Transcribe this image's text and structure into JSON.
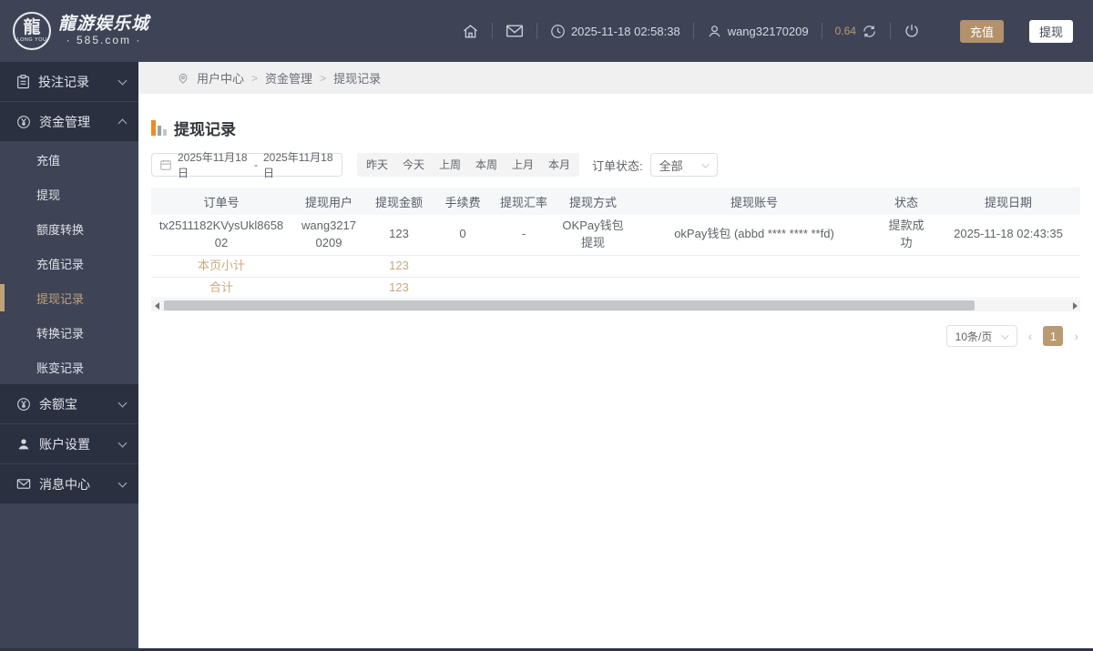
{
  "topbar": {
    "brand_cn": "龍游娱乐城",
    "brand_sub": "· 585.com ·",
    "brand_badge": "LONG YOU",
    "brand_glyph": "龍",
    "datetime": "2025-11-18 02:58:38",
    "username": "wang32170209",
    "balance": "0.64",
    "deposit_label": "充值",
    "withdraw_label": "提现"
  },
  "sidebar": {
    "groups": [
      "投注记录",
      "资金管理",
      "余额宝",
      "账户设置",
      "消息中心"
    ],
    "funds_children": [
      "充值",
      "提现",
      "额度转换",
      "充值记录",
      "提现记录",
      "转换记录",
      "账变记录"
    ],
    "active_item": "提现记录"
  },
  "breadcrumb": {
    "separator": ">",
    "items": [
      "用户中心",
      "资金管理",
      "提现记录"
    ]
  },
  "page": {
    "title": "提现记录"
  },
  "filters": {
    "date_start": "2025年11月18日",
    "date_sep": "-",
    "date_end": "2025年11月18日",
    "quick_ranges": [
      "昨天",
      "今天",
      "上周",
      "本周",
      "上月",
      "本月"
    ],
    "status_label": "订单状态:",
    "status_value": "全部"
  },
  "table": {
    "headers": [
      "订单号",
      "提现用户",
      "提现金额",
      "手续费",
      "提现汇率",
      "提现方式",
      "提现账号",
      "状态",
      "提现日期"
    ],
    "rows": [
      [
        "tx2511182KVysUkl865802",
        "wang32170209",
        "123",
        "0",
        "-",
        "OKPay钱包提现",
        "okPay钱包 (abbd **** **** **fd)",
        "提款成功",
        "2025-11-18 02:43:35"
      ]
    ],
    "subtotal_label": "本页小计",
    "subtotal_value": "123",
    "total_label": "合计",
    "total_value": "123"
  },
  "pagination": {
    "page_size": "10条/页",
    "current_page": "1"
  },
  "colors": {
    "accent_tan": "#b89b72",
    "accent_orange": "#ee8c1e",
    "topbar_bg": "#3e4456",
    "sidebar_dark": "#2a3040"
  }
}
